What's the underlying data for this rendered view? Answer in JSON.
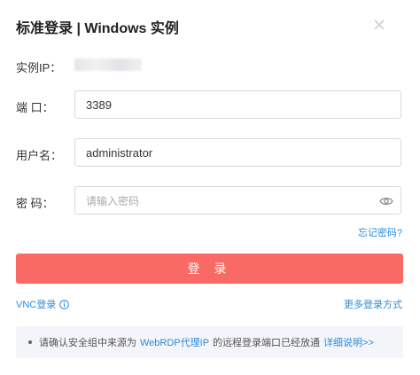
{
  "dialog": {
    "title": "标准登录 | Windows 实例",
    "close_icon": "close-icon"
  },
  "form": {
    "ip_label": "实例IP：",
    "port_label": "端 口：",
    "port_value": "3389",
    "user_label": "用户名：",
    "user_value": "administrator",
    "password_label": "密 码：",
    "password_value": "",
    "password_placeholder": "请输入密码",
    "password_toggle_icon": "eye-icon",
    "forgot_label": "忘记密码?"
  },
  "actions": {
    "login_label": "登 录",
    "vnc_label": "VNC登录",
    "vnc_info_icon": "info-icon",
    "more_label": "更多登录方式"
  },
  "notice": {
    "prefix": "请确认安全组中来源为",
    "source_link": "WebRDP代理IP",
    "middle": "的远程登录端口已经放通",
    "details_link": "详细说明>>"
  },
  "colors": {
    "primary_button": "#fa6a64",
    "link": "#2a8bd8"
  }
}
